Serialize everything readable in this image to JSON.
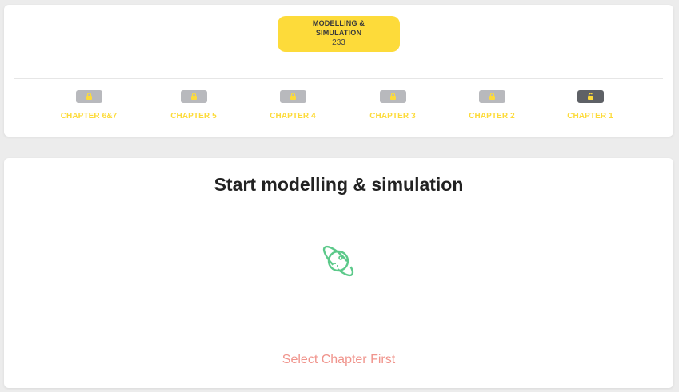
{
  "header": {
    "course_title": "MODELLING & SIMULATION",
    "course_count": "233"
  },
  "chapters": [
    {
      "label": "CHAPTER 6&7",
      "icon": "lock-icon"
    },
    {
      "label": "CHAPTER 5",
      "icon": "lock-icon"
    },
    {
      "label": "CHAPTER 4",
      "icon": "lock-icon"
    },
    {
      "label": "CHAPTER 3",
      "icon": "lock-icon"
    },
    {
      "label": "CHAPTER 2",
      "icon": "lock-icon"
    },
    {
      "label": "CHAPTER 1",
      "icon": "unlock-icon"
    }
  ],
  "main": {
    "title": "Start modelling & simulation",
    "icon": "planet-icon",
    "message": "Select Chapter First"
  },
  "colors": {
    "accent_yellow": "#fddb3a",
    "lock_gray": "#b8b9bd",
    "lock_active": "#5e6166",
    "icon_green": "#5cc98a",
    "message_red": "#f0948c"
  }
}
